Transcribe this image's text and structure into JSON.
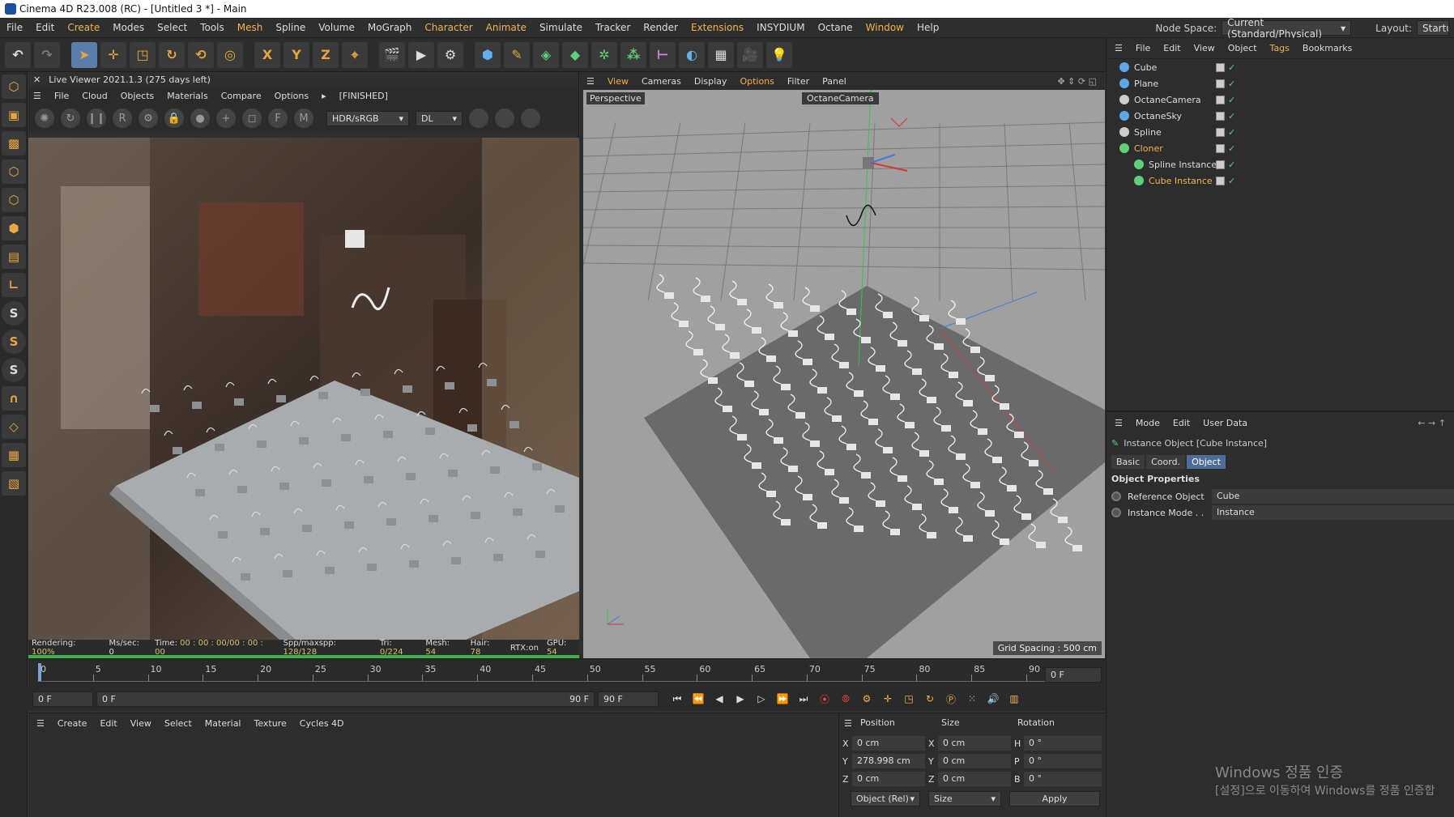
{
  "window": {
    "title": "Cinema 4D R23.008 (RC) - [Untitled 3 *] - Main"
  },
  "menubar": {
    "items": [
      "File",
      "Edit",
      "Create",
      "Modes",
      "Select",
      "Tools",
      "Mesh",
      "Spline",
      "Volume",
      "MoGraph",
      "Character",
      "Animate",
      "Simulate",
      "Tracker",
      "Render",
      "Extensions",
      "INSYDIUM",
      "Octane",
      "Window",
      "Help"
    ],
    "highlighted": [
      "Create",
      "Mesh",
      "Character",
      "Animate",
      "Extensions",
      "Window"
    ],
    "node_space_label": "Node Space:",
    "node_space_value": "Current (Standard/Physical)",
    "layout_label": "Layout:",
    "layout_value": "Startu"
  },
  "toolbar": {
    "axes": [
      "X",
      "Y",
      "Z"
    ]
  },
  "live_viewer": {
    "title": "Live Viewer 2021.1.3 (275 days left)",
    "menu": [
      "File",
      "Cloud",
      "Objects",
      "Materials",
      "Compare",
      "Options"
    ],
    "status": "[FINISHED]",
    "color_space": "HDR/sRGB",
    "kernel": "DL",
    "render_stats": {
      "rendering_label": "Rendering:",
      "rendering": "100%",
      "ms_label": "Ms/sec:",
      "ms": "0",
      "time_label": "Time:",
      "time": "00 : 00 : 00/00 : 00 : 00",
      "spp_label": "Spp/maxspp:",
      "spp": "128/128",
      "tri_label": "Tri:",
      "tri": "0/224",
      "mesh_label": "Mesh:",
      "mesh": "54",
      "hair_label": "Hair:",
      "hair": "78",
      "rtx": "RTX:on",
      "gpu_label": "GPU:",
      "gpu": "54"
    }
  },
  "viewport": {
    "menu": [
      "View",
      "Cameras",
      "Display",
      "Options",
      "Filter",
      "Panel"
    ],
    "highlighted": "Options",
    "view_name": "Perspective",
    "camera": "OctaneCamera",
    "grid_spacing": "Grid Spacing : 500 cm"
  },
  "object_manager": {
    "menu": [
      "File",
      "Edit",
      "View",
      "Object",
      "Tags",
      "Bookmarks"
    ],
    "highlighted": "Tags",
    "objects": [
      {
        "name": "Cube",
        "color": "#5fa8e8",
        "indent": 0,
        "hi": false
      },
      {
        "name": "Plane",
        "color": "#5fa8e8",
        "indent": 0,
        "hi": false
      },
      {
        "name": "OctaneCamera",
        "color": "#ccc",
        "indent": 0,
        "hi": false
      },
      {
        "name": "OctaneSky",
        "color": "#5fa8e8",
        "indent": 0,
        "hi": false
      },
      {
        "name": "Spline",
        "color": "#cccccc",
        "indent": 0,
        "hi": false
      },
      {
        "name": "Cloner",
        "color": "#5fd07a",
        "indent": 0,
        "hi": true
      },
      {
        "name": "Spline Instance",
        "color": "#5fd07a",
        "indent": 1,
        "hi": false
      },
      {
        "name": "Cube Instance",
        "color": "#5fd07a",
        "indent": 1,
        "hi": true
      }
    ]
  },
  "attributes": {
    "menu": [
      "Mode",
      "Edit",
      "User Data"
    ],
    "object_title": "Instance Object [Cube Instance]",
    "tabs": [
      "Basic",
      "Coord.",
      "Object"
    ],
    "active_tab": "Object",
    "section": "Object Properties",
    "props": [
      {
        "label": "Reference Object",
        "value": "Cube"
      },
      {
        "label": "Instance Mode . .",
        "value": "Instance"
      }
    ]
  },
  "timeline": {
    "ticks": [
      "0",
      "5",
      "10",
      "15",
      "20",
      "25",
      "30",
      "35",
      "40",
      "45",
      "50",
      "55",
      "60",
      "65",
      "70",
      "75",
      "80",
      "85",
      "90"
    ],
    "current_frame": "0 F",
    "start": "0 F",
    "range_start": "0 F",
    "range_end": "90 F",
    "end": "90 F"
  },
  "material_manager": {
    "menu": [
      "Create",
      "Edit",
      "View",
      "Select",
      "Material",
      "Texture",
      "Cycles 4D"
    ]
  },
  "coordinates": {
    "headers": [
      "Position",
      "Size",
      "Rotation"
    ],
    "rows": [
      {
        "axis": "X",
        "pos": "0 cm",
        "saxis": "X",
        "size": "0 cm",
        "raxis": "H",
        "rot": "0 °"
      },
      {
        "axis": "Y",
        "pos": "278.998 cm",
        "saxis": "Y",
        "size": "0 cm",
        "raxis": "P",
        "rot": "0 °"
      },
      {
        "axis": "Z",
        "pos": "0 cm",
        "saxis": "Z",
        "size": "0 cm",
        "raxis": "B",
        "rot": "0 °"
      }
    ],
    "mode": "Object (Rel)",
    "size_mode": "Size",
    "apply": "Apply"
  },
  "watermark": {
    "line1": "Windows 정품 인증",
    "line2": "[설정]으로 이동하여 Windows를 정품 인증합"
  }
}
